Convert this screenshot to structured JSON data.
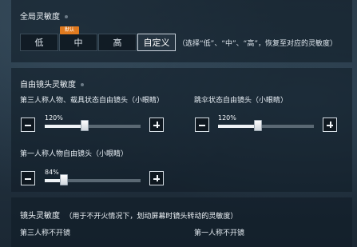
{
  "global": {
    "title": "全局灵敏度",
    "badge": "默认",
    "options": [
      "低",
      "中",
      "高",
      "自定义"
    ],
    "selected": "自定义",
    "hint": "（选择“低”、“中”、“高”，恢复至对应的灵敏度）"
  },
  "free_camera": {
    "title": "自由镜头灵敏度",
    "sliders": [
      {
        "label": "第三人称人物、载具状态自由镜头（小眼睛）",
        "value_text": "120%",
        "level": 0.42
      },
      {
        "label": "跳伞状态自由镜头（小眼睛）",
        "value_text": "120%",
        "level": 0.42
      },
      {
        "label": "第一人称人物自由镜头（小眼睛）",
        "value_text": "84%",
        "level": 0.2
      }
    ]
  },
  "camera": {
    "title": "镜头灵敏度",
    "subtitle": "（用于不开火情况下，划动屏幕时镜头转动的灵敏度）",
    "third_person": "第三人称不开镜",
    "first_person": "第一人称不开镜"
  },
  "icons": {
    "minus": "minus-icon",
    "plus": "plus-icon"
  },
  "colors": {
    "badge": "#e07a1f",
    "fill": "#eef2f5",
    "track": "#5a6873"
  }
}
